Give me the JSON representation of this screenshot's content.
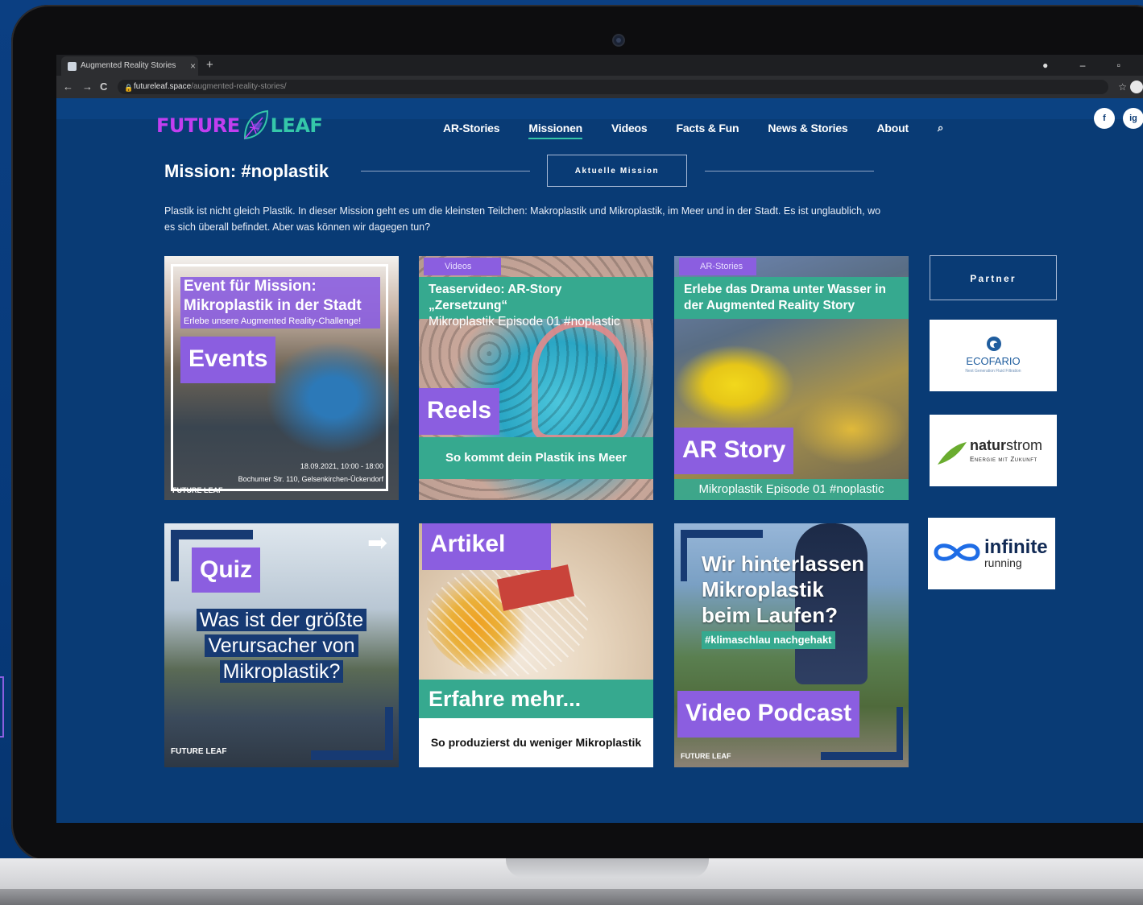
{
  "colors": {
    "site_bg": "#093b75",
    "accent_purple": "#8b5ee0",
    "accent_teal": "#36a98f"
  },
  "browser": {
    "tab_title": "Augmented Reality Stories",
    "tab_close": "×",
    "new_tab": "+",
    "url_host": "futureleaf.space",
    "url_path": "/augmented-reality-stories/",
    "back": "←",
    "forward": "→",
    "reload": "C",
    "star": "☆"
  },
  "site": {
    "logo": {
      "future": "FUTURE",
      "leaf": "LEAF"
    },
    "nav": [
      "AR-Stories",
      "Missionen",
      "Videos",
      "Facts & Fun",
      "News & Stories",
      "About"
    ],
    "social": [
      "f",
      "ig"
    ],
    "mission": {
      "title": "Mission: #noplastik",
      "button": "Aktuelle Mission",
      "intro": "Plastik ist nicht gleich Plastik. In dieser Mission geht es um die kleinsten Teilchen: Makroplastik und Mikroplastik, im Meer und in der Stadt. Es ist unglaublich, wo es sich überall befindet. Aber was können wir dagegen tun?"
    },
    "tiles": {
      "events": {
        "heading1": "Event für Mission:",
        "heading2": "Mikroplastik in der Stadt",
        "subline": "Erlebe unsere Augmented Reality-Challenge!",
        "label": "Events",
        "date": "18.09.2021, 10:00 - 18:00",
        "address": "Bochumer Str. 110, Gelsenkirchen-Ückendorf",
        "logo": "FUTURE LEAF"
      },
      "reels": {
        "tag": "Videos",
        "title": "Teaservideo: AR-Story „Zersetzung“",
        "subtitle": "Mikroplastik Episode 01 #noplastic",
        "label": "Reels",
        "cta": "So kommt dein Plastik ins Meer"
      },
      "ar": {
        "tag": "AR-Stories",
        "title1": "Erlebe das Drama unter Wasser in",
        "title2": "der Augmented Reality Story",
        "label": "AR Story",
        "footer": "Mikroplastik Episode 01 #noplastic"
      },
      "quiz": {
        "label": "Quiz",
        "q1": "Was ist der größte",
        "q2": "Verursacher von",
        "q3": "Mikroplastik?",
        "logo": "FUTURE LEAF"
      },
      "artikel": {
        "label": "Artikel",
        "cta": "Erfahre mehr...",
        "caption": "So produzierst du weniger Mikroplastik"
      },
      "video": {
        "l1": "Wir hinterlassen",
        "l2": "Mikroplastik",
        "l3": "beim Laufen?",
        "hashtag": "#klimaschlau nachgehakt",
        "label": "Video Podcast",
        "logo": "FUTURE LEAF"
      }
    },
    "partner": {
      "heading": "Partner",
      "ecofario": "ECOFARIO",
      "ecofario_sub": "Next Generation Fluid Filtration",
      "naturstrom_a": "natur",
      "naturstrom_b": "strom",
      "naturstrom_sub": "Energie mit Zukunft",
      "infinite": "infinite",
      "infinite_sub": "running"
    }
  }
}
